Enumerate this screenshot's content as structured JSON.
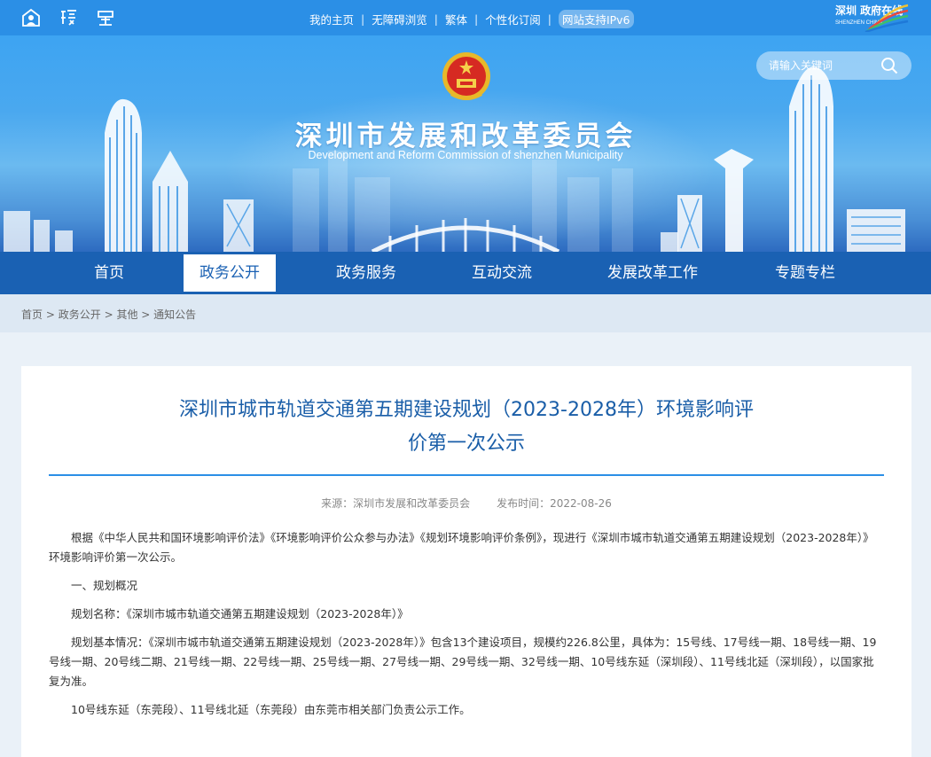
{
  "topbar": {
    "links": [
      "我的主页",
      "无障碍浏览",
      "繁体",
      "个性化订阅"
    ],
    "ipv6_badge": "网站支持IPv6",
    "right_logo_text": "深圳 政府在线",
    "right_logo_subtext": "SHENZHEN CHINA"
  },
  "banner": {
    "title": "深圳市发展和改革委员会",
    "subtitle": "Development and Reform Commission of shenzhen Municipality",
    "search_placeholder": "请输入关键词"
  },
  "nav": {
    "items": [
      "首页",
      "政务公开",
      "政务服务",
      "互动交流",
      "发展改革工作",
      "专题专栏"
    ],
    "active": "政务公开"
  },
  "breadcrumb": [
    "首页",
    "政务公开",
    "其他",
    "通知公告"
  ],
  "article": {
    "title_line1": "深圳市城市轨道交通第五期建设规划（2023-2028年）环境影响评",
    "title_line2": "价第一次公示",
    "source_label": "来源：深圳市发展和改革委员会",
    "date_label": "发布时间：2022-08-26",
    "paragraphs": [
      "根据《中华人民共和国环境影响评价法》《环境影响评价公众参与办法》《规划环境影响评价条例》，现进行《深圳市城市轨道交通第五期建设规划（2023-2028年）》环境影响评价第一次公示。",
      "一、规划概况",
      "规划名称：《深圳市城市轨道交通第五期建设规划（2023-2028年）》",
      "规划基本情况：《深圳市城市轨道交通第五期建设规划（2023-2028年）》包含13个建设项目，规模约226.8公里，具体为：15号线、17号线一期、18号线一期、19号线一期、20号线二期、21号线一期、22号线一期、25号线一期、27号线一期、29号线一期、32号线一期、10号线东延（深圳段）、11号线北延（深圳段），以国家批复为准。",
      "10号线东延（东莞段）、11号线北延（东莞段）由东莞市相关部门负责公示工作。"
    ]
  },
  "colors": {
    "topbar": "#2b8fe6",
    "nav": "#1a61b3",
    "title": "#1a5ea8",
    "rule": "#2b8fe6"
  }
}
